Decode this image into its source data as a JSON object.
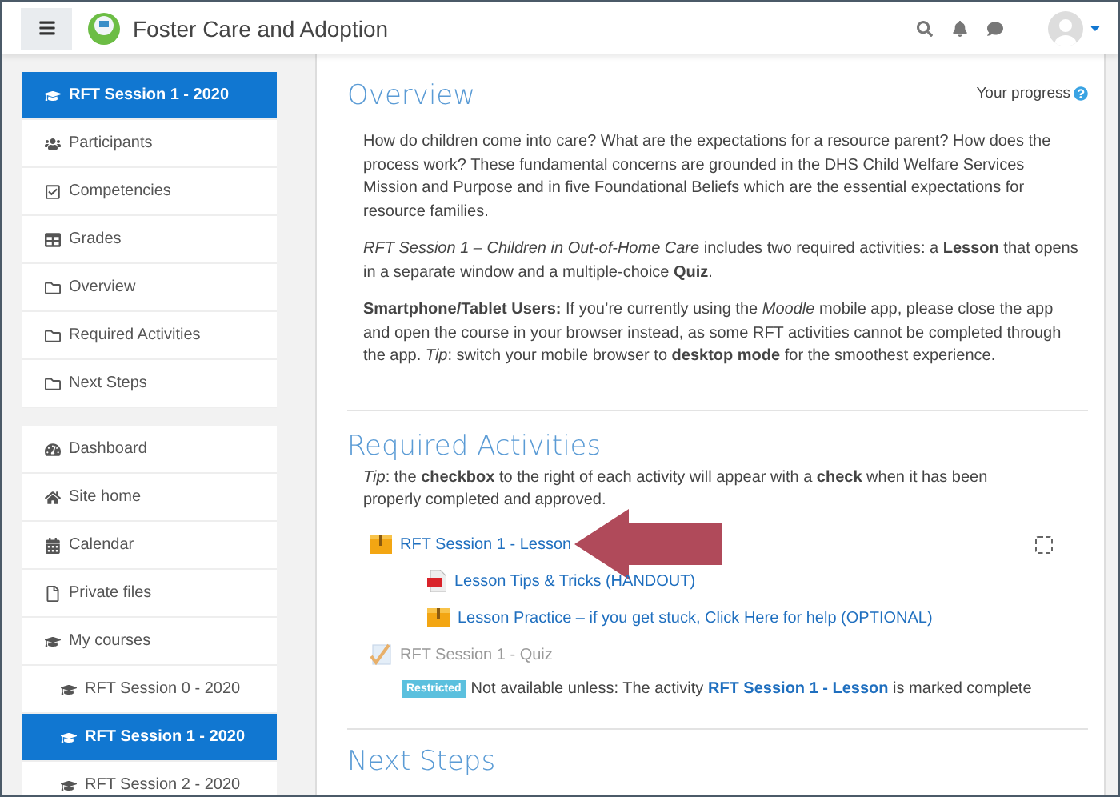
{
  "header": {
    "site_title": "Foster Care and Adoption"
  },
  "sidebar": {
    "sections": [
      [
        {
          "label": "RFT Session 1 - 2020",
          "selected": true
        },
        {
          "label": "Participants",
          "selected": false
        },
        {
          "label": "Competencies",
          "selected": false
        },
        {
          "label": "Grades",
          "selected": false
        },
        {
          "label": "Overview",
          "selected": false
        },
        {
          "label": "Required Activities",
          "selected": false
        },
        {
          "label": "Next Steps",
          "selected": false
        }
      ],
      [
        {
          "label": "Dashboard",
          "selected": false
        },
        {
          "label": "Site home",
          "selected": false
        },
        {
          "label": "Calendar",
          "selected": false
        },
        {
          "label": "Private files",
          "selected": false
        },
        {
          "label": "My courses",
          "selected": false,
          "children": [
            {
              "label": "RFT Session 0 - 2020",
              "selected": false
            },
            {
              "label": "RFT Session 1 - 2020",
              "selected": true
            },
            {
              "label": "RFT Session 2 - 2020",
              "selected": false
            }
          ]
        }
      ]
    ]
  },
  "main": {
    "overview": {
      "title": "Overview",
      "progress_label": "Your progress",
      "paragraphs": [
        "How do children come into care? What are the expectations for a resource parent? How does the process work? These fundamental concerns are grounded in the DHS Child Welfare Services Mission and Purpose and in five Foundational Beliefs which are the essential expectations for resource families.",
        "*RFT Session 1 – Children in Out-of-Home Care* includes two required activities: a **Lesson** that opens in a separate window and a multiple-choice **Quiz**.",
        "**Smartphone/Tablet Users:** If you’re currently using the *Moodle* mobile app, please close the app and open the course in your browser instead, as some RFT activities cannot be completed through the app. *Tip*: switch your mobile browser to **desktop mode** for the smoothest experience."
      ]
    },
    "required": {
      "title": "Required Activities",
      "tip": "*Tip*: the **checkbox** to the right of each activity will appear with a **check** when it has been properly completed and approved.",
      "activities": [
        {
          "label": "RFT Session 1 - Lesson",
          "kind": "lesson",
          "available": true,
          "completed": false,
          "children": [
            {
              "label": "Lesson Tips & Tricks (HANDOUT)",
              "kind": "pdf",
              "available": true
            },
            {
              "label": "Lesson Practice – if you get stuck, Click Here for help (OPTIONAL)",
              "kind": "lesson",
              "available": true
            }
          ]
        },
        {
          "label": "RFT Session 1 - Quiz",
          "kind": "quiz",
          "available": false,
          "restriction": {
            "badge": "Restricted",
            "text": "Not available unless: The activity **RFT Session 1 - Lesson** is marked complete"
          }
        }
      ]
    },
    "next_steps": {
      "title": "Next Steps"
    }
  }
}
